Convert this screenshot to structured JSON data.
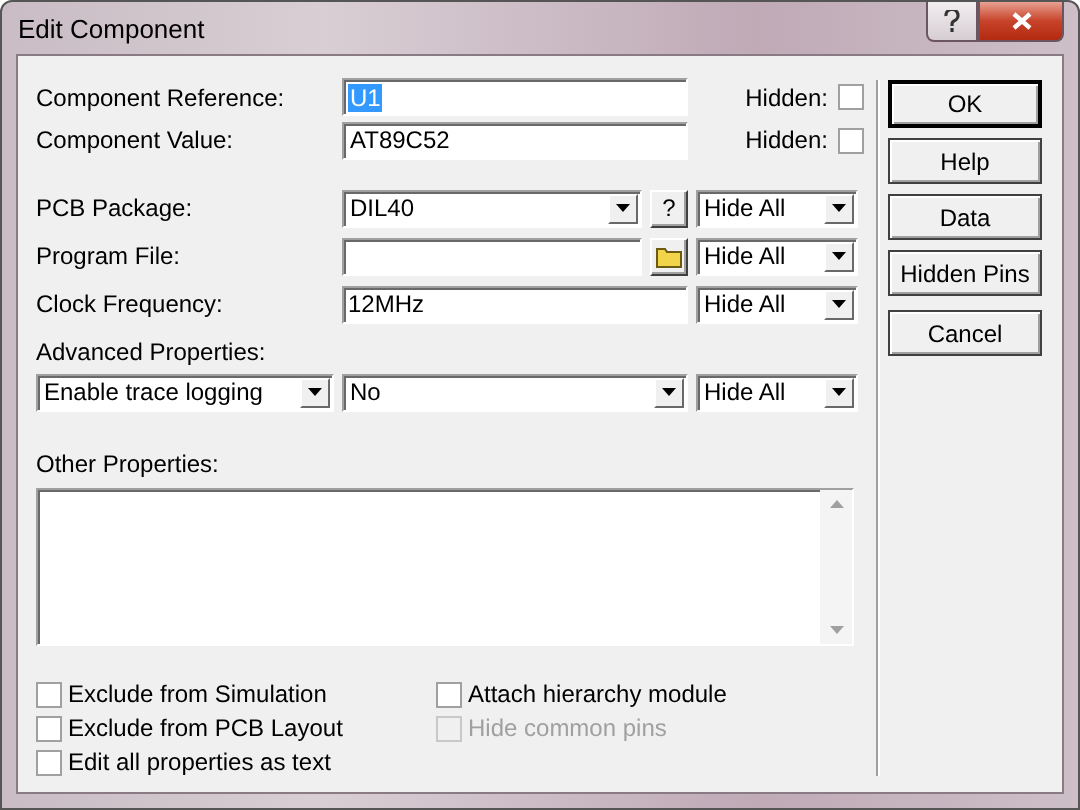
{
  "window": {
    "title": "Edit Component"
  },
  "identity": [
    {
      "label": "Component Reference:",
      "value": "U1",
      "value_selected": true,
      "hidden_label": "Hidden:",
      "hidden": false
    },
    {
      "label": "Component Value:",
      "value": "AT89C52",
      "value_selected": false,
      "hidden_label": "Hidden:",
      "hidden": false
    }
  ],
  "properties": [
    {
      "kind": "combo",
      "label": "PCB Package:",
      "value": "DIL40",
      "button": "?",
      "visibility": "Hide All"
    },
    {
      "kind": "file",
      "label": "Program File:",
      "visibility": "Hide All"
    },
    {
      "kind": "text",
      "label": "Clock Frequency:",
      "value": "12MHz",
      "visibility": "Hide All"
    }
  ],
  "advanced": {
    "label": "Advanced Properties:",
    "property": "Enable trace logging",
    "value": "No",
    "visibility": "Hide All"
  },
  "other": {
    "label": "Other Properties:"
  },
  "options": [
    {
      "label": "Exclude from Simulation",
      "checked": false,
      "disabled": false
    },
    {
      "label": "Attach hierarchy module",
      "checked": false,
      "disabled": false
    },
    {
      "label": "Exclude from PCB Layout",
      "checked": false,
      "disabled": false
    },
    {
      "label": "Hide common pins",
      "checked": false,
      "disabled": true
    },
    {
      "label": "Edit all properties as text",
      "checked": false,
      "disabled": false
    }
  ],
  "buttons": [
    {
      "label": "OK",
      "default": true
    },
    {
      "label": "Help",
      "default": false
    },
    {
      "label": "Data",
      "default": false
    },
    {
      "label": "Hidden Pins",
      "default": false
    },
    {
      "label": "Cancel",
      "default": false
    }
  ]
}
